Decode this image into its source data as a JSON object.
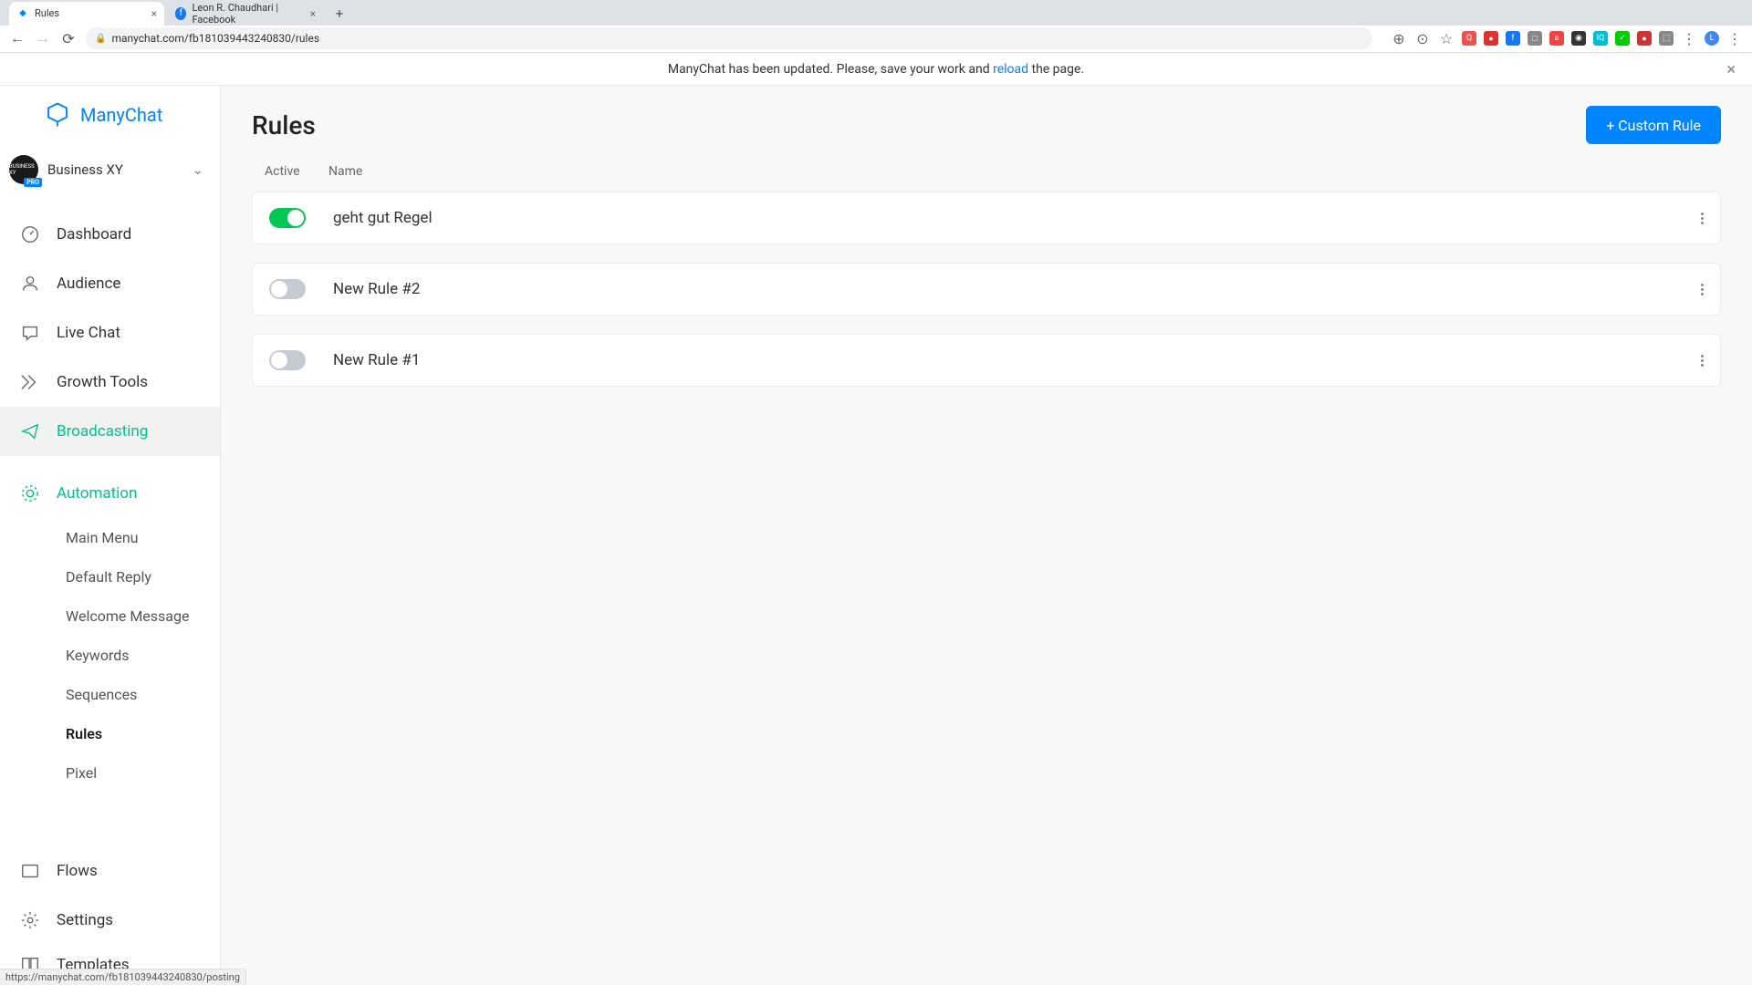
{
  "browser": {
    "tabs": [
      {
        "title": "Rules",
        "favicon_color": "#0084ff",
        "active": true
      },
      {
        "title": "Leon R. Chaudhari | Facebook",
        "favicon_color": "#1877f2",
        "active": false
      }
    ],
    "url": "manychat.com/fb181039443240830/rules",
    "status_url": "https://manychat.com/fb181039443240830/posting"
  },
  "banner": {
    "text_before": "ManyChat has been updated. Please, save your work and ",
    "link_text": "reload",
    "text_after": " the page."
  },
  "brand": "ManyChat",
  "business": {
    "name": "Business XY",
    "badge": "PRO"
  },
  "nav": {
    "dashboard": "Dashboard",
    "audience": "Audience",
    "live_chat": "Live Chat",
    "growth_tools": "Growth Tools",
    "broadcasting": "Broadcasting",
    "automation": "Automation",
    "flows": "Flows",
    "settings": "Settings",
    "templates": "Templates"
  },
  "automation_sub": {
    "main_menu": "Main Menu",
    "default_reply": "Default Reply",
    "welcome_message": "Welcome Message",
    "keywords": "Keywords",
    "sequences": "Sequences",
    "rules": "Rules",
    "pixel": "Pixel"
  },
  "page": {
    "title": "Rules",
    "create_button": "+ Custom Rule"
  },
  "columns": {
    "active": "Active",
    "name": "Name"
  },
  "rules": [
    {
      "name": "geht gut Regel",
      "active": true
    },
    {
      "name": "New Rule #2",
      "active": false
    },
    {
      "name": "New Rule #1",
      "active": false
    }
  ]
}
